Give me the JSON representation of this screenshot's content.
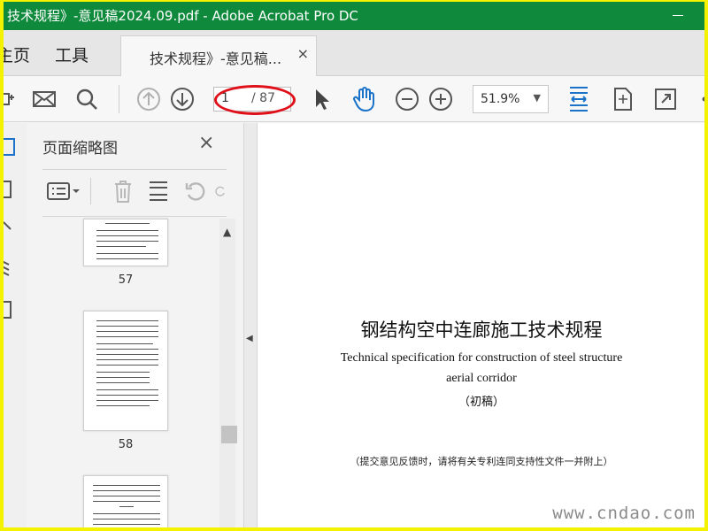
{
  "window": {
    "title": "技术规程》-意见稿2024.09.pdf - Adobe Acrobat Pro DC"
  },
  "menu": {
    "home": "主页",
    "tools": "工具"
  },
  "tab": {
    "label": "技术规程》-意见稿...",
    "close": "×"
  },
  "toolbar": {
    "page_current": "1",
    "page_total": "/ 87",
    "zoom": "51.9%"
  },
  "thumbnails_panel": {
    "title": "页面缩略图",
    "close": "×",
    "pages": [
      "57",
      "58"
    ]
  },
  "document": {
    "title_cn": "钢结构空中连廊施工技术规程",
    "title_en_line1": "Technical specification for construction of steel structure",
    "title_en_line2": "aerial corridor",
    "draft": "（初稿）",
    "note": "（提交意见反馈时，请将有关专利连同支持性文件一并附上）"
  },
  "watermark": "www.cndao.com",
  "colors": {
    "titlebar": "#0f8a3c",
    "accent": "#1a73c9",
    "highlight": "#e0101a",
    "border": "#f4f200"
  }
}
